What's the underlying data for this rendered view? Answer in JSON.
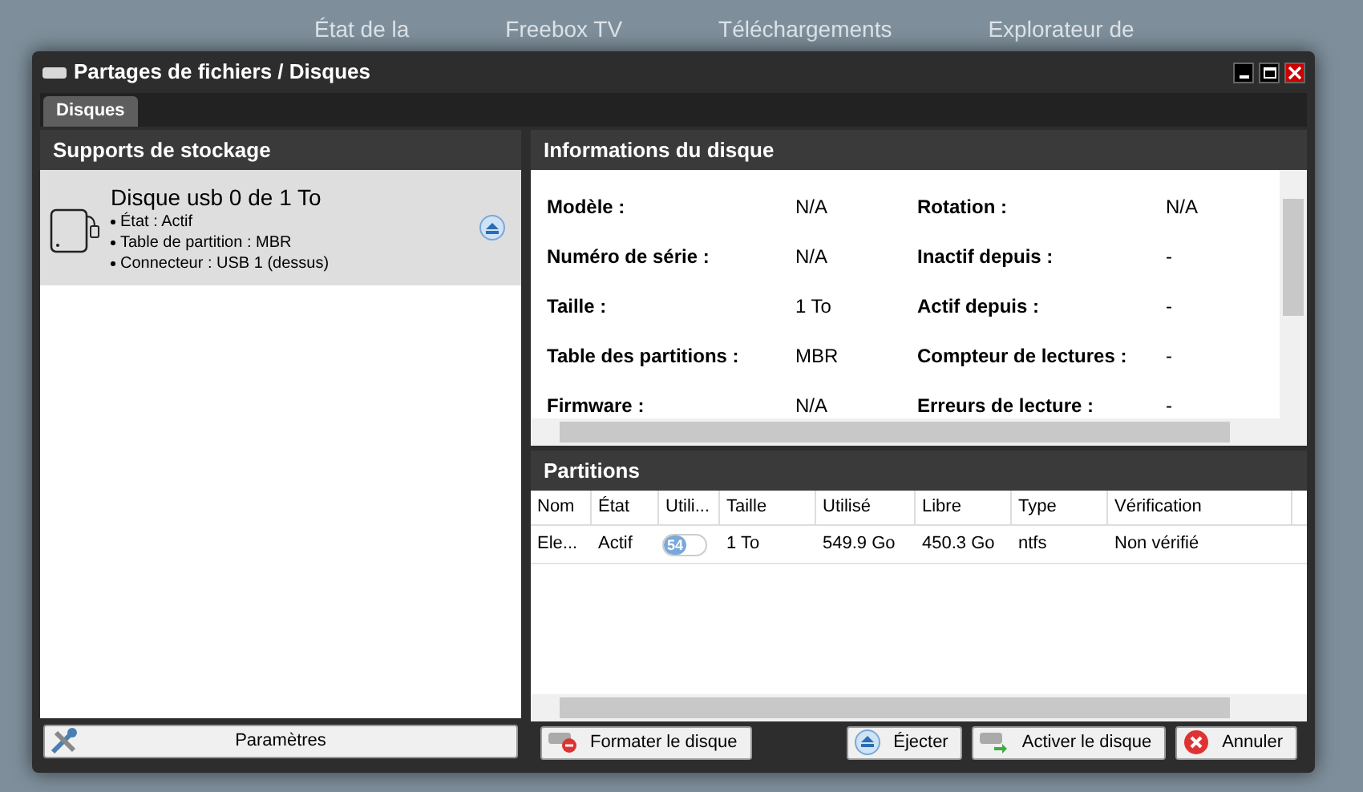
{
  "background_nav": [
    "État de la",
    "Freebox TV",
    "Téléchargements",
    "Explorateur de"
  ],
  "window": {
    "title": "Partages de fichiers / Disques"
  },
  "tabs": [
    {
      "label": "Disques",
      "selected": true
    }
  ],
  "storage": {
    "header": "Supports de stockage",
    "items": [
      {
        "title": "Disque usb 0 de 1 To",
        "details": [
          "État : Actif",
          "Table de partition : MBR",
          "Connecteur : USB 1 (dessus)"
        ],
        "selected": true
      }
    ],
    "settings_button": "Paramètres"
  },
  "disk_info": {
    "header": "Informations du disque",
    "fields": [
      {
        "label": "Modèle :",
        "value": "N/A"
      },
      {
        "label": "Rotation :",
        "value": "N/A"
      },
      {
        "label": "Numéro de série :",
        "value": "N/A"
      },
      {
        "label": "Inactif depuis :",
        "value": "-"
      },
      {
        "label": "Taille :",
        "value": "1 To"
      },
      {
        "label": "Actif depuis :",
        "value": "-"
      },
      {
        "label": "Table des partitions :",
        "value": "MBR"
      },
      {
        "label": "Compteur de lectures :",
        "value": "-"
      },
      {
        "label": "Firmware :",
        "value": "N/A"
      },
      {
        "label": "Erreurs de lecture :",
        "value": "-"
      }
    ]
  },
  "partitions": {
    "header": "Partitions",
    "columns": [
      "Nom",
      "État",
      "Utili...",
      "Taille",
      "Utilisé",
      "Libre",
      "Type",
      "Vérification"
    ],
    "rows": [
      {
        "name": "Ele...",
        "state": "Actif",
        "usage": {
          "level": 0.54,
          "label": "54"
        },
        "size": "1 To",
        "used": "549.9 Go",
        "free": "450.3 Go",
        "type": "ntfs",
        "check": "Non vérifié"
      }
    ]
  },
  "buttons": [
    {
      "label": "Formater le disque",
      "kind": "format"
    },
    {
      "label": "Éjecter",
      "kind": "eject"
    },
    {
      "label": "Activer le disque",
      "kind": "activate"
    },
    {
      "label": "Annuler",
      "kind": "cancel"
    }
  ]
}
